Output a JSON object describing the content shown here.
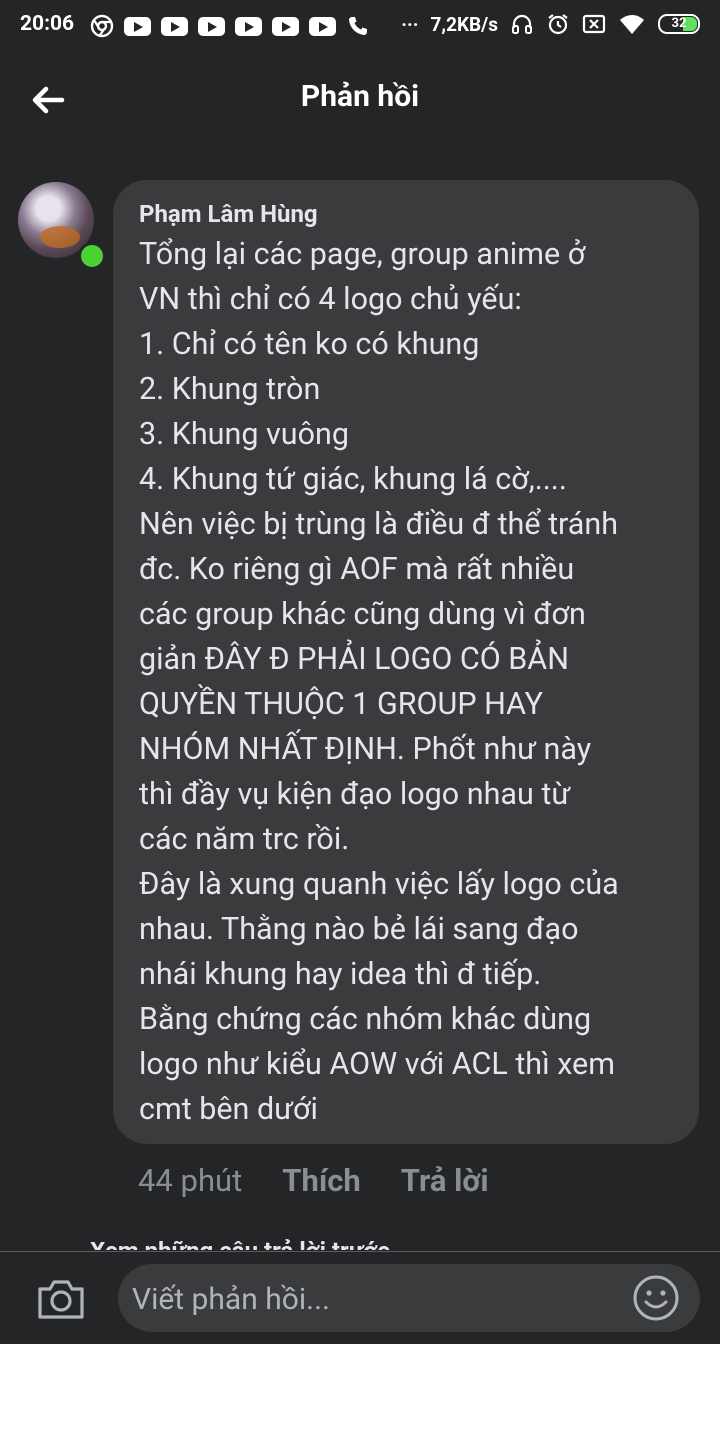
{
  "status_bar": {
    "time": "20:06",
    "speed": "7,2KB/s",
    "battery": "32",
    "icons": [
      "chrome-icon",
      "youtube-icon",
      "youtube-icon",
      "youtube-icon",
      "youtube-icon",
      "youtube-icon",
      "youtube-icon",
      "phone-icon",
      "more-dots",
      "headset-icon",
      "alarm-icon",
      "sim-off-icon",
      "wifi-icon",
      "battery-icon"
    ]
  },
  "header": {
    "title": "Phản hồi",
    "back_icon": "back-arrow-icon"
  },
  "comment": {
    "author": "Phạm Lâm Hùng",
    "online": true,
    "lines": [
      "Tổng lại các page, group anime ở",
      "VN thì chỉ có 4 logo chủ yếu:",
      "1. Chỉ có tên ko có khung",
      "2. Khung tròn",
      "3. Khung vuông",
      "4. Khung tứ giác, khung lá cờ,....",
      "Nên việc bị trùng là điều đ thể tránh",
      "đc. Ko riêng gì AOF mà rất nhiều",
      "các group khác cũng dùng vì đơn",
      "giản ĐÂY Đ PHẢI LOGO CÓ BẢN",
      "QUYỀN THUỘC 1 GROUP HAY",
      "NHÓM NHẤT ĐỊNH. Phốt như này",
      "thì đầy vụ kiện đạo logo nhau từ",
      "các năm trc rồi.",
      "Đây là xung quanh việc lấy logo của",
      "nhau. Thằng nào bẻ lái sang đạo",
      "nhái khung hay idea thì đ tiếp.",
      "Bằng chứng các nhóm khác dùng",
      "logo như kiểu AOW với ACL thì xem",
      "cmt bên dưới"
    ],
    "time_ago": "44 phút",
    "like_label": "Thích",
    "reply_label": "Trả lời"
  },
  "previous_replies_label": "Xem những câu trả lời trước",
  "composer": {
    "placeholder": "Viết phản hồi...",
    "camera_icon": "camera-icon",
    "emoji_icon": "smile-icon"
  },
  "colors": {
    "background": "#242527",
    "bubble": "#3a3b3c",
    "text": "#e4e6eb",
    "meta": "#8a8d91",
    "online": "#4cd137"
  }
}
